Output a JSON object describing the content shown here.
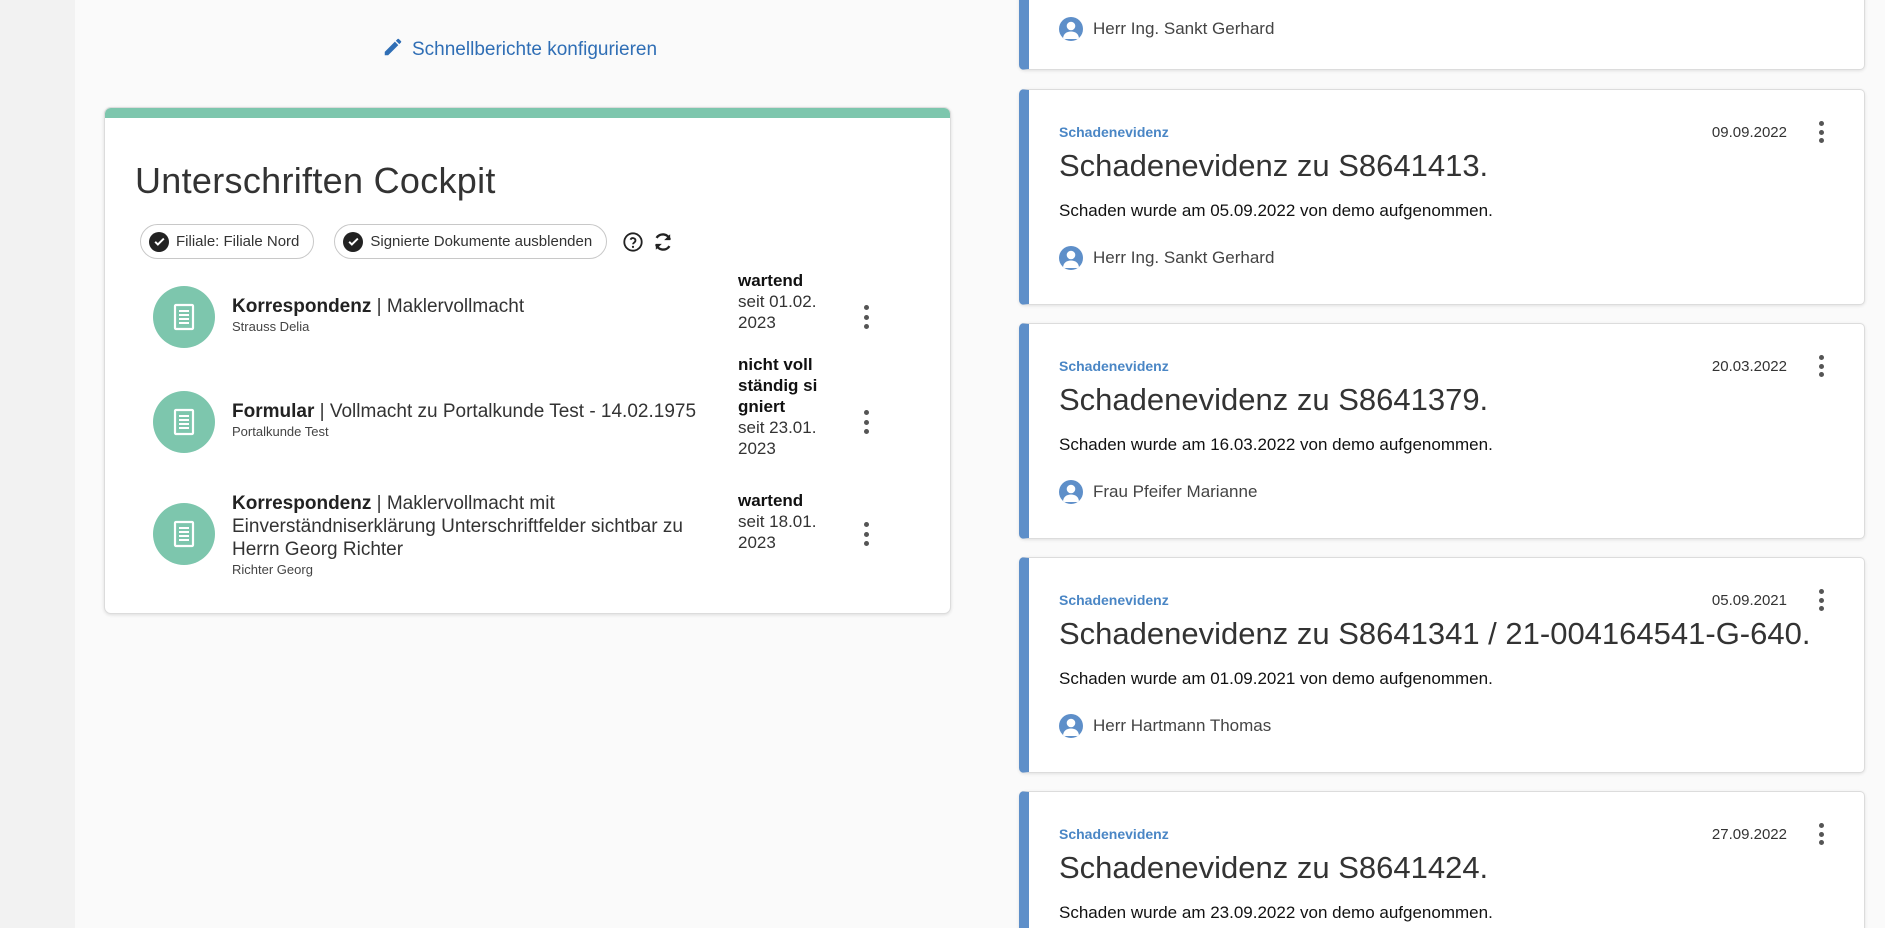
{
  "quick_reports": {
    "config_label": "Schnellberichte konfigurieren"
  },
  "cockpit": {
    "title": "Unterschriften Cockpit",
    "filters": [
      {
        "label": "Filiale: Filiale Nord"
      },
      {
        "label": "Signierte Dokumente ausblenden"
      }
    ],
    "documents": [
      {
        "type": "Korrespondenz",
        "name": "Maklervollmacht",
        "person": "Strauss Delia",
        "status": "wartend",
        "since": "seit 01.02.2023"
      },
      {
        "type": "Formular",
        "name": "Vollmacht zu Portalkunde Test - 14.02.1975",
        "person": "Portalkunde Test",
        "status": "nicht vollständig signiert",
        "since": "seit 23.01.2023"
      },
      {
        "type": "Korrespondenz",
        "name": "Maklervollmacht mit Einverständniserklärung Unterschriftfelder sichtbar zu Herrn Georg Richter",
        "person": "Richter Georg",
        "status": "wartend",
        "since": "seit 18.01.2023"
      }
    ]
  },
  "feed": {
    "top_partial": {
      "person": "Herr Ing. Sankt Gerhard"
    },
    "cards": [
      {
        "type": "Schadenevidenz",
        "date": "09.09.2022",
        "title": "Schadenevidenz zu S8641413.",
        "description": "Schaden wurde am 05.09.2022 von demo aufgenommen.",
        "person": "Herr Ing. Sankt Gerhard"
      },
      {
        "type": "Schadenevidenz",
        "date": "20.03.2022",
        "title": "Schadenevidenz zu S8641379.",
        "description": "Schaden wurde am 16.03.2022 von demo aufgenommen.",
        "person": "Frau Pfeifer Marianne"
      },
      {
        "type": "Schadenevidenz",
        "date": "05.09.2021",
        "title": "Schadenevidenz zu S8641341 / 21-004164541-G-640.",
        "description": "Schaden wurde am 01.09.2021 von demo aufgenommen.",
        "person": "Herr Hartmann Thomas"
      },
      {
        "type": "Schadenevidenz",
        "date": "27.09.2022",
        "title": "Schadenevidenz zu S8641424.",
        "description": "Schaden wurde am 23.09.2022 von demo aufgenommen."
      }
    ]
  },
  "colors": {
    "accent_green": "#7dc6ad",
    "accent_blue": "#5e8fc9",
    "link_blue": "#2f6eb5"
  },
  "icons": {
    "config": "pencil-icon",
    "filter_checked": "check-circle-icon",
    "help": "help-circle-icon",
    "refresh": "refresh-icon",
    "document": "document-icon",
    "person": "person-icon",
    "more": "more-vert-icon"
  }
}
